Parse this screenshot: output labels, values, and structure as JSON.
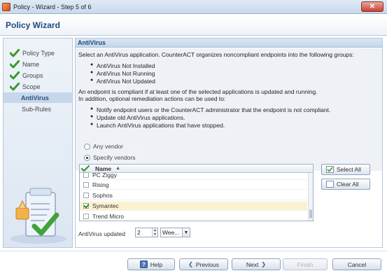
{
  "window": {
    "title": "Policy - Wizard - Step 5 of 6",
    "close_label": "✕"
  },
  "header": {
    "title": "Policy Wizard"
  },
  "nav": {
    "items": [
      {
        "label": "Policy Type",
        "done": true
      },
      {
        "label": "Name",
        "done": true
      },
      {
        "label": "Groups",
        "done": true
      },
      {
        "label": "Scope",
        "done": true
      },
      {
        "label": "AntiVirus",
        "active": true
      },
      {
        "label": "Sub-Rules"
      }
    ]
  },
  "section": {
    "title": "AntiVirus",
    "intro": "Select an AntiVirus application. CounterACT organizes noncompliant endpoints into the following groups:",
    "groups": [
      "AntiVirus Not Installed",
      "AntiVirus Not Running",
      "AntiVirus Not Updated"
    ],
    "compliance_line1": "An endpoint is compliant if at least one of the selected applications is updated and running.",
    "compliance_line2": "In addition, optional remediation actions can be used to:",
    "actions": [
      "Notify endpoint users or the CounterACT administrator that the endpoint is not compliant.",
      "Update old AntiVirus applications.",
      "Launch AntiVirus applications that have stopped."
    ]
  },
  "vendor_mode": {
    "any_label": "Any vendor",
    "specify_label": "Specify vendors",
    "selected": "specify"
  },
  "vendor_table": {
    "column_header": "Name",
    "sort_indicator": "▲",
    "rows": [
      {
        "name": "PC Ziggy",
        "checked": false
      },
      {
        "name": "Rising",
        "checked": false
      },
      {
        "name": "Sophos",
        "checked": false
      },
      {
        "name": "Symantec",
        "checked": true,
        "selected": true
      },
      {
        "name": "Trend Micro",
        "checked": false
      }
    ]
  },
  "buttons": {
    "select_all": "Select All",
    "clear_all": "Clear All"
  },
  "updated": {
    "label": "AntiVirus updated",
    "value": "2",
    "unit": "Wee..."
  },
  "footer": {
    "help": "Help",
    "previous": "Previous",
    "next": "Next",
    "finish": "Finish",
    "cancel": "Cancel"
  },
  "colors": {
    "accent": "#1f4a7a",
    "check_green": "#3a9a2e",
    "selected_row": "#fbf1cf"
  }
}
